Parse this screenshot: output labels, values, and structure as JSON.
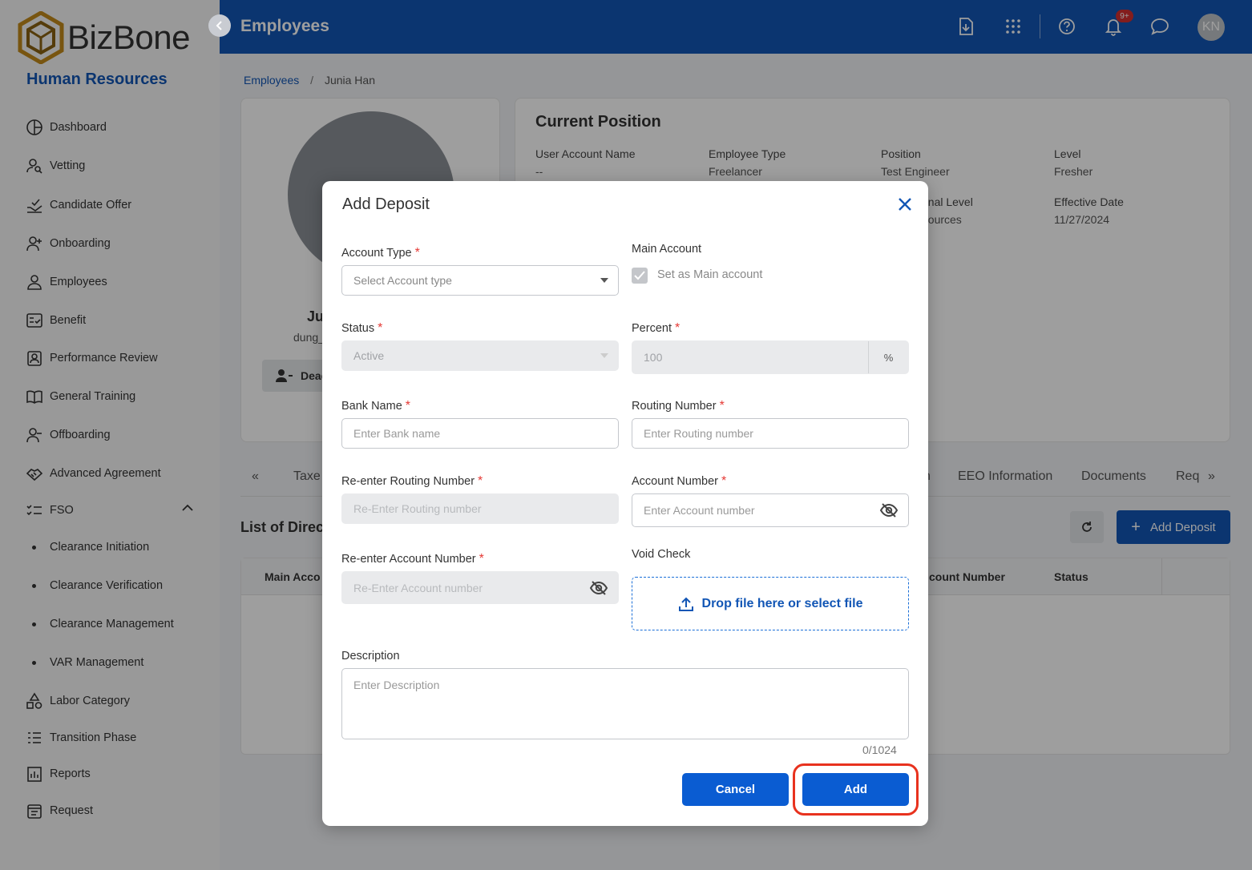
{
  "app": {
    "brand": "BizBone",
    "module": "Human Resources",
    "page_title": "Employees",
    "notifications_count": "9+",
    "user_initials": "KN"
  },
  "sidebar": {
    "items": [
      {
        "label": "Dashboard",
        "icon": "dashboard-icon"
      },
      {
        "label": "Vetting",
        "icon": "vetting-icon"
      },
      {
        "label": "Candidate Offer",
        "icon": "candidate-offer-icon"
      },
      {
        "label": "Onboarding",
        "icon": "onboarding-icon"
      },
      {
        "label": "Employees",
        "icon": "employees-icon"
      },
      {
        "label": "Benefit",
        "icon": "benefit-icon"
      },
      {
        "label": "Performance Review",
        "icon": "performance-review-icon"
      },
      {
        "label": "General Training",
        "icon": "general-training-icon"
      },
      {
        "label": "Offboarding",
        "icon": "offboarding-icon"
      },
      {
        "label": "Advanced Agreement",
        "icon": "agreement-icon"
      },
      {
        "label": "FSO",
        "icon": "fso-icon"
      },
      {
        "label": "Labor Category",
        "icon": "labor-category-icon"
      },
      {
        "label": "Transition Phase",
        "icon": "transition-phase-icon"
      },
      {
        "label": "Reports",
        "icon": "reports-icon"
      },
      {
        "label": "Request",
        "icon": "request-icon"
      }
    ],
    "fso_subitems": [
      "Clearance Initiation",
      "Clearance Verification",
      "Clearance Management",
      "VAR Management"
    ]
  },
  "breadcrumb": {
    "root": "Employees",
    "sep": "/",
    "current": "Junia Han"
  },
  "profile": {
    "name_partial": "Ju",
    "username_partial": "dung_",
    "deactivate_partial": "Deac"
  },
  "position": {
    "title": "Current Position",
    "user_account_name_label": "User Account Name",
    "user_account_name_value": "--",
    "employee_type_label": "Employee Type",
    "employee_type_value": "Freelancer",
    "position_label": "Position",
    "position_value": "Test Engineer",
    "level_label": "Level",
    "level_value": "Fresher",
    "org_level_label_partial": "tional Level",
    "org_level_value_partial": "esources",
    "effective_date_label": "Effective Date",
    "effective_date_value": "11/27/2024"
  },
  "tabs": {
    "prev": "«",
    "taxes_partial": "Taxe",
    "partial_n": "n",
    "eeo": "EEO Information",
    "documents": "Documents",
    "req_partial": "Req",
    "next": "»"
  },
  "list": {
    "title_partial": "List of Direc",
    "add_deposit_label": "Add Deposit",
    "columns": {
      "main_account_partial": "Main Acco",
      "account_number_partial": "count Number",
      "status": "Status"
    }
  },
  "modal": {
    "title": "Add Deposit",
    "account_type_label": "Account Type",
    "account_type_placeholder": "Select Account type",
    "main_account_label": "Main Account",
    "set_main_label": "Set as Main account",
    "set_main_checked": true,
    "status_label": "Status",
    "status_value": "Active",
    "percent_label": "Percent",
    "percent_value": "100",
    "percent_suffix": "%",
    "bank_name_label": "Bank Name",
    "bank_name_placeholder": "Enter Bank name",
    "routing_label": "Routing Number",
    "routing_placeholder": "Enter Routing number",
    "reroute_label": "Re-enter Routing Number",
    "reroute_placeholder": "Re-Enter Routing number",
    "account_number_label": "Account Number",
    "account_number_placeholder": "Enter Account number",
    "reaccount_label": "Re-enter Account Number",
    "reaccount_placeholder": "Re-Enter Account number",
    "void_check_label": "Void Check",
    "dropzone_text": "Drop file here or select file",
    "description_label": "Description",
    "description_placeholder": "Enter Description",
    "counter": "0/1024",
    "required_mark": "*",
    "cancel_label": "Cancel",
    "add_label": "Add"
  },
  "colors": {
    "primary": "#1256b5",
    "button": "#0a5cd2",
    "required": "#e53935",
    "highlight": "#e8321e"
  }
}
